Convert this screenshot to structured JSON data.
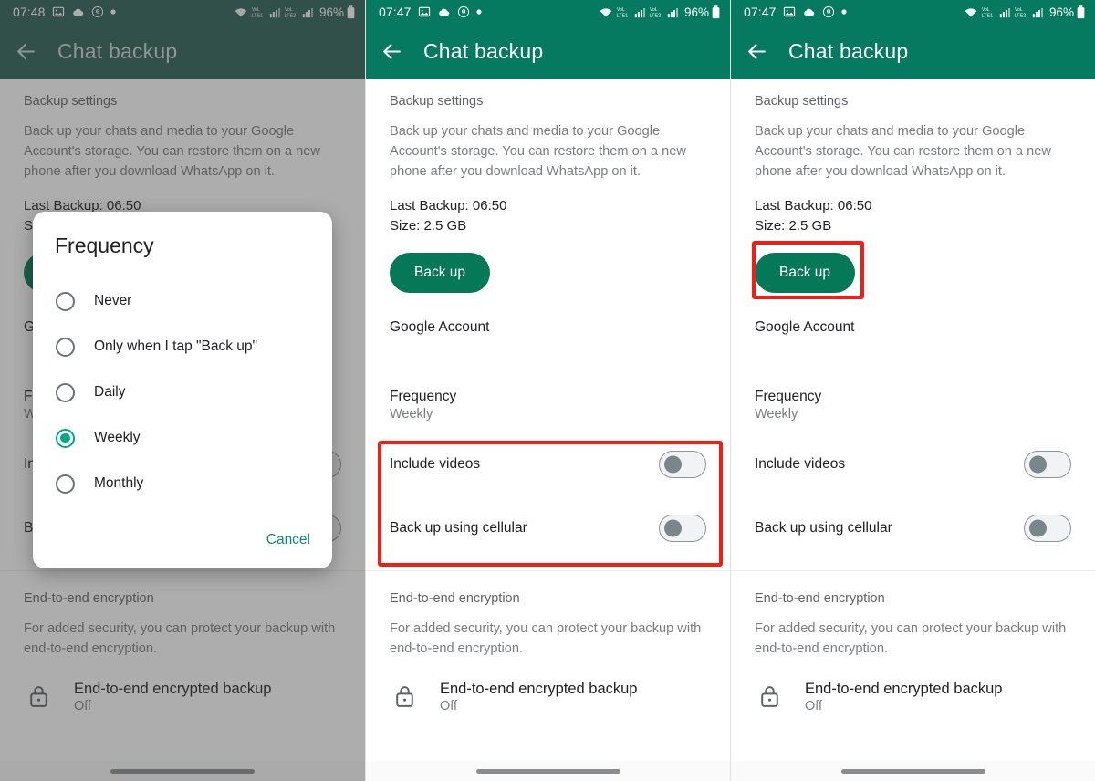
{
  "statusbar": {
    "time_panel1": "07:48",
    "time_panel2": "07:47",
    "time_panel3": "07:47",
    "battery_pct": "96%",
    "net1": "LTE1",
    "net2": "LTE2",
    "volte": "VoLTE",
    "icons": [
      "image-icon",
      "cloud-icon",
      "threads-icon",
      "dot-icon",
      "wifi-icon",
      "signal-icon",
      "battery-icon"
    ]
  },
  "appbar": {
    "title": "Chat backup",
    "back_icon": "back-arrow-icon"
  },
  "sections": {
    "backup_settings_label": "Backup settings",
    "description": "Back up your chats and media to your Google Account's storage. You can restore them on a new phone after you download WhatsApp on it.",
    "last_backup": "Last Backup: 06:50",
    "size": "Size: 2.5 GB",
    "backup_button": "Back up",
    "google_account_label": "Google Account",
    "frequency_label": "Frequency",
    "frequency_value": "Weekly",
    "include_videos_label": "Include videos",
    "include_videos_state": "off",
    "cellular_label": "Back up using cellular",
    "cellular_state": "off"
  },
  "encryption": {
    "section_label": "End-to-end encryption",
    "description": "For added security, you can protect your backup with end-to-end encryption.",
    "item_title": "End-to-end encrypted backup",
    "item_state": "Off",
    "lock_icon": "lock-icon"
  },
  "dialog": {
    "title": "Frequency",
    "options": [
      {
        "label": "Never",
        "selected": false
      },
      {
        "label": "Only when I tap \"Back up\"",
        "selected": false
      },
      {
        "label": "Daily",
        "selected": false
      },
      {
        "label": "Weekly",
        "selected": true
      },
      {
        "label": "Monthly",
        "selected": false
      }
    ],
    "cancel_label": "Cancel"
  },
  "colors": {
    "header_green": "#067A60",
    "button_green": "#047857",
    "accent_green": "#00A884",
    "annotation_red": "#f01e14",
    "toggle_knob": "#79868c"
  },
  "annotations": {
    "panel2_highlight": "toggle-rows",
    "panel3_highlight": "back-up-button"
  }
}
